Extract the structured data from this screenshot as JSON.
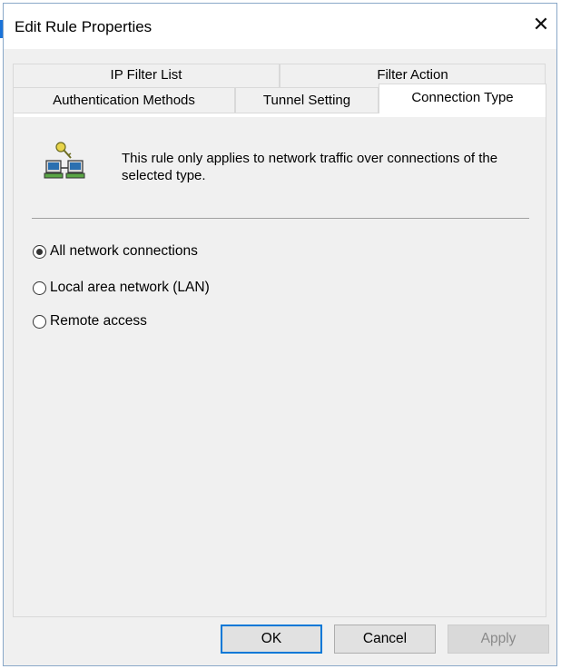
{
  "window": {
    "title": "Edit Rule Properties",
    "close_glyph": "✕"
  },
  "tabs": {
    "ip_filter_list": "IP Filter List",
    "filter_action": "Filter Action",
    "authentication_methods": "Authentication Methods",
    "tunnel_setting": "Tunnel Setting",
    "connection_type": "Connection Type",
    "active": "Connection Type"
  },
  "panel": {
    "icon": "network-computers-key-icon",
    "description": "This rule only applies to network traffic over connections of the selected type.",
    "options": [
      {
        "label": "All network connections",
        "selected": true
      },
      {
        "label": "Local area network (LAN)",
        "selected": false
      },
      {
        "label": "Remote access",
        "selected": false
      }
    ]
  },
  "buttons": {
    "ok": "OK",
    "cancel": "Cancel",
    "apply": "Apply",
    "apply_enabled": false
  },
  "colors": {
    "accent": "#0078d7",
    "window_border": "#8aa8c8",
    "dialog_bg": "#f0f0f0"
  }
}
